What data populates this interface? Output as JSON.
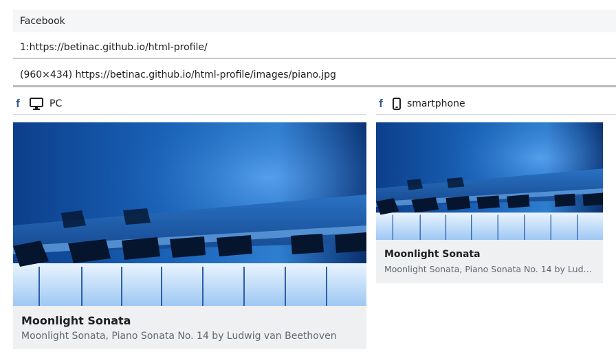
{
  "header": {
    "title": "Facebook",
    "url_line": "1:https://betinac.github.io/html-profile/",
    "image_line": "(960×434) https://betinac.github.io/html-profile/images/piano.jpg"
  },
  "pc": {
    "platform_icon": "facebook-icon",
    "platform_glyph": "f",
    "device_icon": "monitor-icon",
    "device_label": "PC"
  },
  "smartphone": {
    "platform_icon": "facebook-icon",
    "platform_glyph": "f",
    "device_icon": "smartphone-icon",
    "device_label": "smartphone"
  },
  "card": {
    "title": "Moonlight Sonata",
    "description": "Moonlight Sonata, Piano Sonata No. 14 by Ludwig van Beethoven",
    "image": "piano-keys-photo"
  },
  "colors": {
    "facebook_blue": "#3b5998",
    "card_background": "#eff0f2",
    "description_gray": "#606770"
  }
}
